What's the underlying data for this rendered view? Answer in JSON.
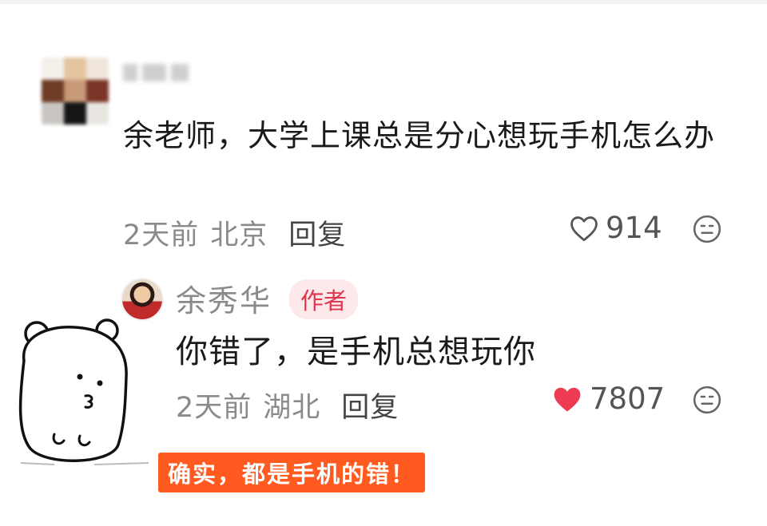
{
  "comment": {
    "text": "余老师，大学上课总是分心想玩手机怎么办",
    "time": "2天前",
    "location": "北京",
    "reply_label": "回复",
    "likes": "914"
  },
  "reply": {
    "author_name": "余秀华",
    "author_badge": "作者",
    "text": "你错了，是手机总想玩你",
    "time": "2天前",
    "location": "湖北",
    "reply_label": "回复",
    "likes": "7807",
    "liked": true
  },
  "caption": "确实，都是手机的错！",
  "colors": {
    "heart_liked": "#ee3b52",
    "badge_bg": "#fde8ea",
    "badge_text": "#e0354f",
    "caption_bg": "#ff5a1f",
    "meta_text": "#8a8a8a"
  },
  "icons": {
    "like_outline": "heart-outline-icon",
    "like_filled": "heart-filled-icon",
    "emoji": "emoji-face-icon"
  }
}
